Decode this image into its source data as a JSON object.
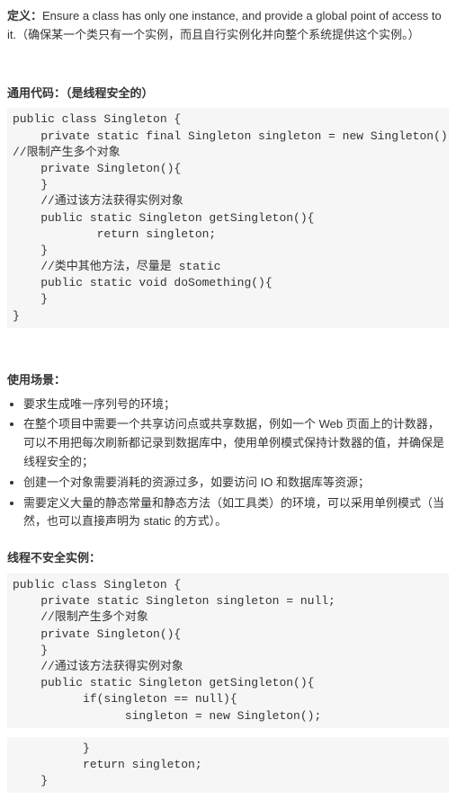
{
  "def_label": "定义：",
  "def_text": "Ensure a class has only one instance, and provide a global point of access to it.（确保某一个类只有一个实例，而且自行实例化并向整个系统提供这个实例。）",
  "section1_title": "通用代码：（是线程安全的）",
  "code1": "public class Singleton {\n    private static final Singleton singleton = new Singleton();\n//限制产生多个对象\n    private Singleton(){\n    }\n    //通过该方法获得实例对象\n    public static Singleton getSingleton(){\n            return singleton;\n    }\n    //类中其他方法，尽量是 static\n    public static void doSomething(){\n    }\n}",
  "usage_title": "使用场景：",
  "usage_items": [
    "要求生成唯一序列号的环境；",
    "在整个项目中需要一个共享访问点或共享数据，例如一个 Web 页面上的计数器，可以不用把每次刷新都记录到数据库中，使用单例模式保持计数器的值，并确保是线程安全的；",
    "创建一个对象需要消耗的资源过多，如要访问 IO 和数据库等资源；",
    "需要定义大量的静态常量和静态方法（如工具类）的环境，可以采用单例模式（当然，也可以直接声明为 static 的方式）。"
  ],
  "section2_title": "线程不安全实例：",
  "code2a": "public class Singleton {\n    private static Singleton singleton = null;\n    //限制产生多个对象\n    private Singleton(){\n    }\n    //通过该方法获得实例对象\n    public static Singleton getSingleton(){\n          if(singleton == null){\n                singleton = new Singleton();",
  "code2b": "          }\n          return singleton;\n    }"
}
